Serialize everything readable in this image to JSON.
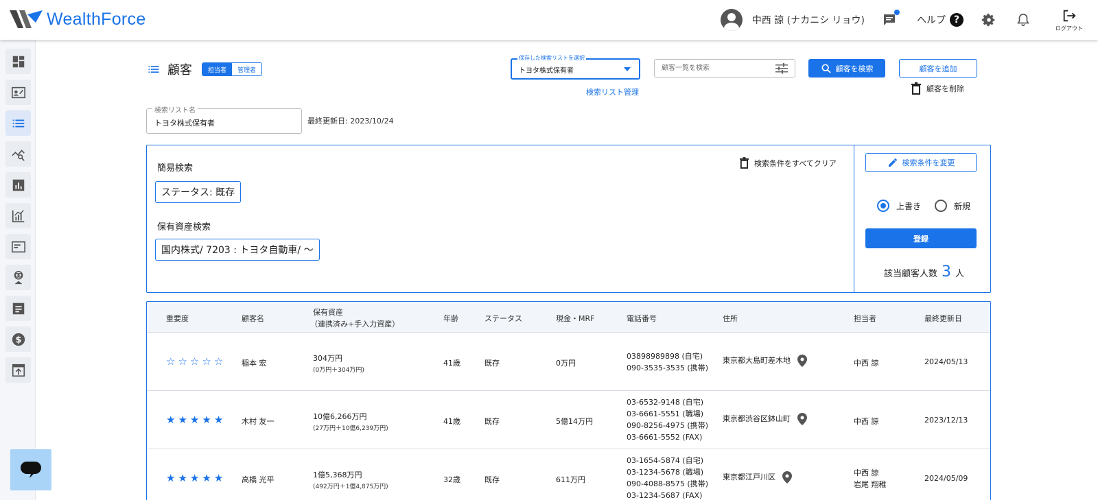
{
  "header": {
    "logo_text": "WealthForce",
    "user_name": "中西 諒 (ナカニシ リョウ)",
    "help_label": "ヘルプ",
    "logout_label": "ログアウト"
  },
  "sidebar": {
    "items": [
      "dashboard-icon",
      "contact-card-icon",
      "list-icon",
      "analytics-search-icon",
      "bar-chart-icon",
      "growth-chart-icon",
      "panel-icon",
      "people-icon",
      "document-icon",
      "dollar-icon",
      "upload-icon"
    ],
    "active_index": 2
  },
  "page": {
    "title": "顧客",
    "role_tabs": [
      "担当者",
      "管理者"
    ],
    "active_role": "担当者"
  },
  "saved_search": {
    "legend": "保存した検索リストを選択",
    "value": "トヨタ株式保有者",
    "manage_link": "検索リスト管理"
  },
  "search": {
    "placeholder": "顧客一覧を検索",
    "search_button": "顧客を検索",
    "add_button": "顧客を追加",
    "delete_label": "顧客を削除"
  },
  "list_name": {
    "legend": "検索リスト名",
    "value": "トヨタ株式保有者",
    "last_updated": "最終更新日: 2023/10/24"
  },
  "criteria": {
    "simple_label": "簡易検索",
    "simple_chip": "ステータス: 既存",
    "asset_label": "保有資産検索",
    "asset_chip": "国内株式/ 7203 : トヨタ自動車/ 〜",
    "clear_all": "検索条件をすべてクリア",
    "change_button": "検索条件を変更",
    "radio_overwrite": "上書き",
    "radio_new": "新規",
    "selected_radio": "上書き",
    "register_button": "登録",
    "count_prefix": "該当顧客人数",
    "count_value": "3",
    "count_suffix": "人"
  },
  "table": {
    "headers": {
      "importance": "重要度",
      "name": "顧客名",
      "assets": "保有資産",
      "assets_sub": "（連携済み+手入力資産）",
      "age": "年齢",
      "status": "ステータス",
      "cash": "現金・MRF",
      "phone": "電話番号",
      "address": "住所",
      "manager": "担当者",
      "updated": "最終更新日"
    },
    "rows": [
      {
        "stars": 0,
        "name": "稲本 宏",
        "assets": "304万円",
        "assets_sub": "(0万円＋304万円)",
        "age": "41歳",
        "status": "既存",
        "cash": "0万円",
        "phones": [
          "03898989898 (自宅)",
          "090-3535-3535 (携帯)"
        ],
        "address": "東京都大島町差木地",
        "managers": [
          "中西 諒"
        ],
        "updated": "2024/05/13"
      },
      {
        "stars": 5,
        "name": "木村 友一",
        "assets": "10億6,266万円",
        "assets_sub": "(27万円＋10億6,239万円)",
        "age": "41歳",
        "status": "既存",
        "cash": "5億14万円",
        "phones": [
          "03-6532-9148 (自宅)",
          "03-6661-5551 (職場)",
          "090-8256-4975 (携帯)",
          "03-6661-5552 (FAX)"
        ],
        "address": "東京都渋谷区鉢山町",
        "managers": [
          "中西 諒"
        ],
        "updated": "2023/12/13"
      },
      {
        "stars": 5,
        "name": "高橋 光平",
        "assets": "1億5,368万円",
        "assets_sub": "(492万円＋1億4,875万円)",
        "age": "32歳",
        "status": "既存",
        "cash": "611万円",
        "phones": [
          "03-1654-5874 (自宅)",
          "03-1234-5678 (職場)",
          "090-4088-8575 (携帯)",
          "03-1234-5687 (FAX)"
        ],
        "address": "東京都江戸川区",
        "managers": [
          "中西 諒",
          "岩尾 翔稚"
        ],
        "updated": "2024/05/09"
      }
    ]
  },
  "colors": {
    "accent": "#1a73e8",
    "header_bg": "#f2f6fb",
    "support_bg": "#a9d3f7"
  }
}
